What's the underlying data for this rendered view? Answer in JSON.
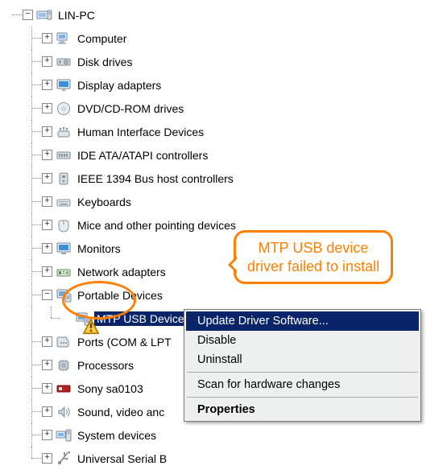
{
  "root": {
    "label": "LIN-PC"
  },
  "categories": [
    {
      "label": "Computer"
    },
    {
      "label": "Disk drives"
    },
    {
      "label": "Display adapters"
    },
    {
      "label": "DVD/CD-ROM drives"
    },
    {
      "label": "Human Interface Devices"
    },
    {
      "label": "IDE ATA/ATAPI controllers"
    },
    {
      "label": "IEEE 1394 Bus host controllers"
    },
    {
      "label": "Keyboards"
    },
    {
      "label": "Mice and other pointing devices"
    },
    {
      "label": "Monitors"
    },
    {
      "label": "Network adapters"
    },
    {
      "label": "Portable Devices"
    },
    {
      "label": "Ports (COM & LPT"
    },
    {
      "label": "Processors"
    },
    {
      "label": "Sony sa0103"
    },
    {
      "label": "Sound, video anc"
    },
    {
      "label": "System devices"
    },
    {
      "label": "Universal Serial B"
    }
  ],
  "selected_child": {
    "label": "MTP USB Device"
  },
  "callout": {
    "line1": "MTP USB device",
    "line2": "driver failed to install"
  },
  "contextMenu": {
    "update": "Update Driver Software...",
    "disable": "Disable",
    "uninstall": "Uninstall",
    "scan": "Scan for hardware changes",
    "properties": "Properties"
  }
}
